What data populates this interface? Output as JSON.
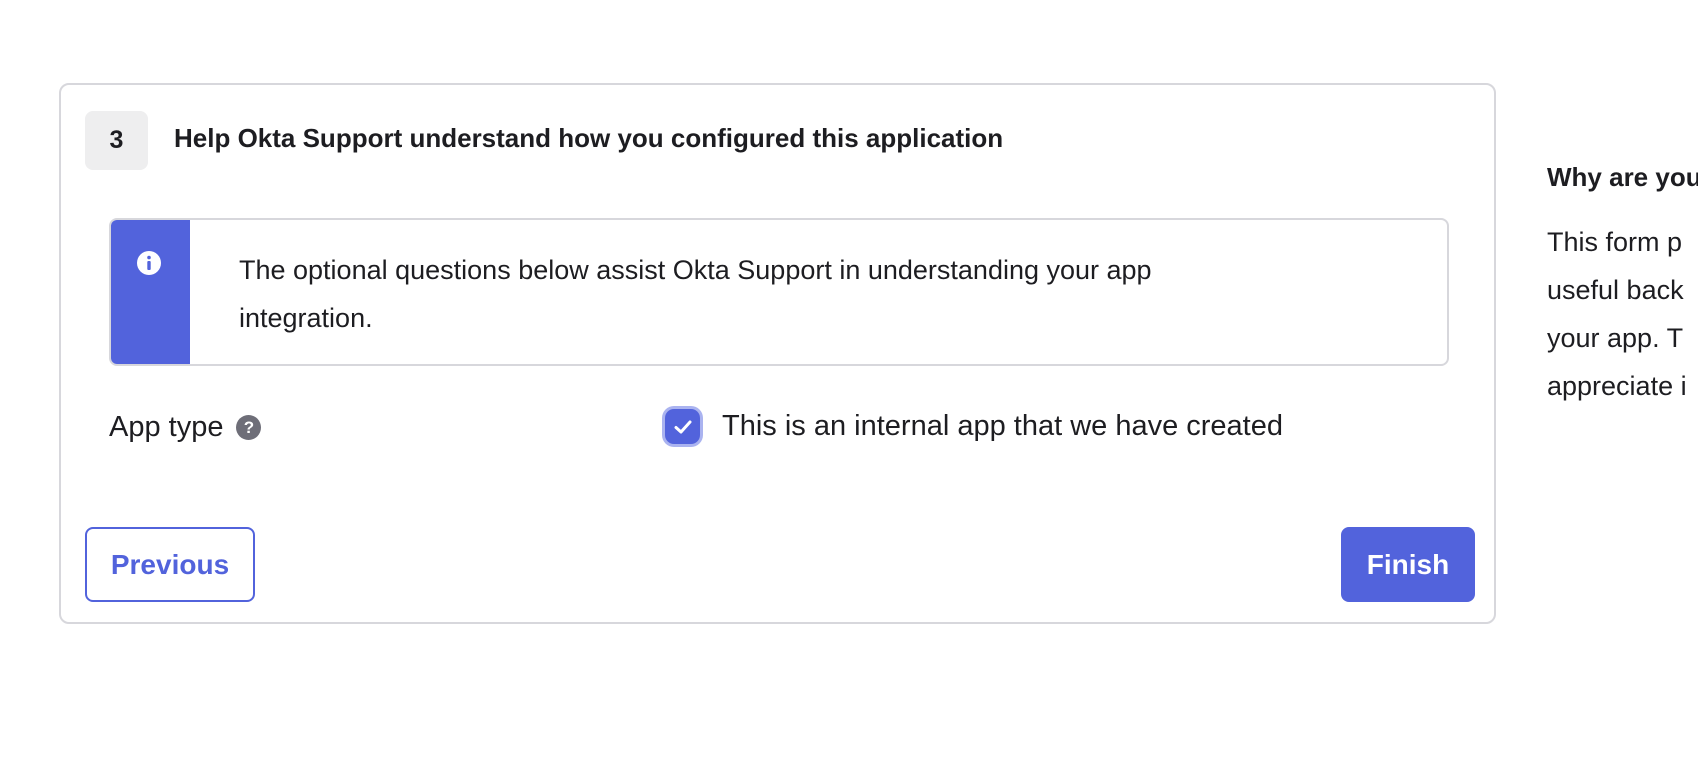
{
  "step": {
    "number": "3",
    "title": "Help Okta Support understand how you configured this application"
  },
  "callout": {
    "icon": "info-icon",
    "text": "The optional questions below assist Okta Support in understanding your app integration."
  },
  "app_type": {
    "label": "App type",
    "help_icon": "question-circle-icon",
    "checkbox_checked": true,
    "checkbox_label": "This is an internal app that we have created"
  },
  "buttons": {
    "previous_label": "Previous",
    "finish_label": "Finish"
  },
  "side_panel": {
    "heading": "Why are you",
    "lines": [
      "This form p",
      "useful back",
      "your app. T",
      "appreciate i"
    ]
  },
  "colors": {
    "accent": "#5263dc",
    "border": "#d7d7dc",
    "text": "#1d1d21"
  }
}
